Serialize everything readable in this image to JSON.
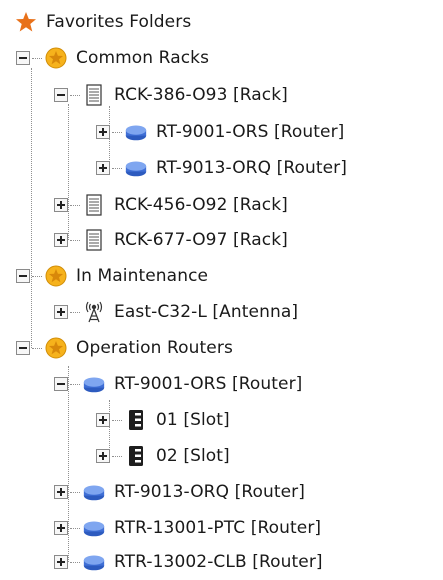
{
  "tree": {
    "root": {
      "label": "Favorites Folders",
      "icon": "star-icon"
    },
    "groups": [
      {
        "label": "Common Racks",
        "icon": "favorite-folder-icon",
        "expanded": true,
        "children": [
          {
            "label": "RCK-386-O93 [Rack]",
            "icon": "rack-icon",
            "expanded": true,
            "children": [
              {
                "label": "RT-9001-ORS [Router]",
                "icon": "router-icon",
                "expanded": false
              },
              {
                "label": "RT-9013-ORQ [Router]",
                "icon": "router-icon",
                "expanded": false
              }
            ]
          },
          {
            "label": "RCK-456-O92 [Rack]",
            "icon": "rack-icon",
            "expanded": false
          },
          {
            "label": "RCK-677-O97 [Rack]",
            "icon": "rack-icon",
            "expanded": false
          }
        ]
      },
      {
        "label": "In Maintenance",
        "icon": "favorite-folder-icon",
        "expanded": true,
        "children": [
          {
            "label": "East-C32-L [Antenna]",
            "icon": "antenna-icon",
            "expanded": false
          }
        ]
      },
      {
        "label": "Operation Routers",
        "icon": "favorite-folder-icon",
        "expanded": true,
        "children": [
          {
            "label": "RT-9001-ORS [Router]",
            "icon": "router-icon",
            "expanded": true,
            "children": [
              {
                "label": "01 [Slot]",
                "icon": "slot-icon",
                "expanded": false
              },
              {
                "label": "02 [Slot]",
                "icon": "slot-icon",
                "expanded": false
              }
            ]
          },
          {
            "label": "RT-9013-ORQ [Router]",
            "icon": "router-icon",
            "expanded": false
          },
          {
            "label": "RTR-13001-PTC [Router]",
            "icon": "router-icon",
            "expanded": false
          },
          {
            "label": "RTR-13002-CLB [Router]",
            "icon": "router-icon",
            "expanded": false
          }
        ]
      }
    ]
  },
  "colors": {
    "star": "#e8711a",
    "favorite_badge": "#f6b21c",
    "router": "#3f6fd6",
    "connector": "#909090"
  }
}
